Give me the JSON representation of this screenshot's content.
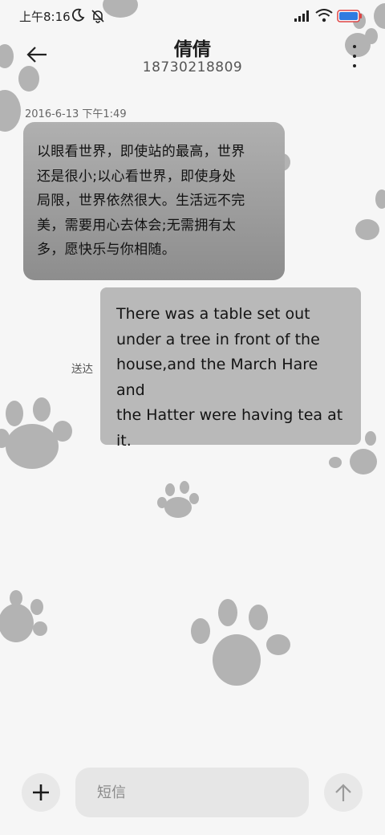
{
  "status_bar": {
    "time": "上午8:16",
    "icons": [
      "moon-icon",
      "mute-icon",
      "signal-icon",
      "wifi-icon",
      "battery-icon"
    ],
    "battery_level": "100"
  },
  "header": {
    "contact_name": "倩倩",
    "contact_number": "18730218809",
    "back_icon": "arrow-left-icon",
    "more_icon": "more-vertical-icon"
  },
  "messages": [
    {
      "direction": "incoming",
      "timestamp": "2016-6-13 下午1:49",
      "lines": [
        "以眼看世界，即使站的最高，世界",
        "还是很小;以心看世界，即使身处",
        "局限，世界依然很大。生活远不完",
        "美，需要用心去体会;无需拥有太",
        "多，愿快乐与你相随。"
      ]
    },
    {
      "direction": "outgoing",
      "status": "送达",
      "lines": [
        "There was a table set out",
        "under a tree in front of the",
        "house,and the March Hare and",
        "the Hatter were having tea at",
        "it."
      ]
    }
  ],
  "composer": {
    "placeholder": "短信",
    "value": "",
    "add_icon": "plus-icon",
    "send_icon": "arrow-up-icon"
  },
  "colors": {
    "background": "#f6f6f6",
    "incoming_bubble": "#9e9e9e",
    "outgoing_bubble": "#b9b9b9",
    "paw_prints": "#b3b3b3"
  }
}
